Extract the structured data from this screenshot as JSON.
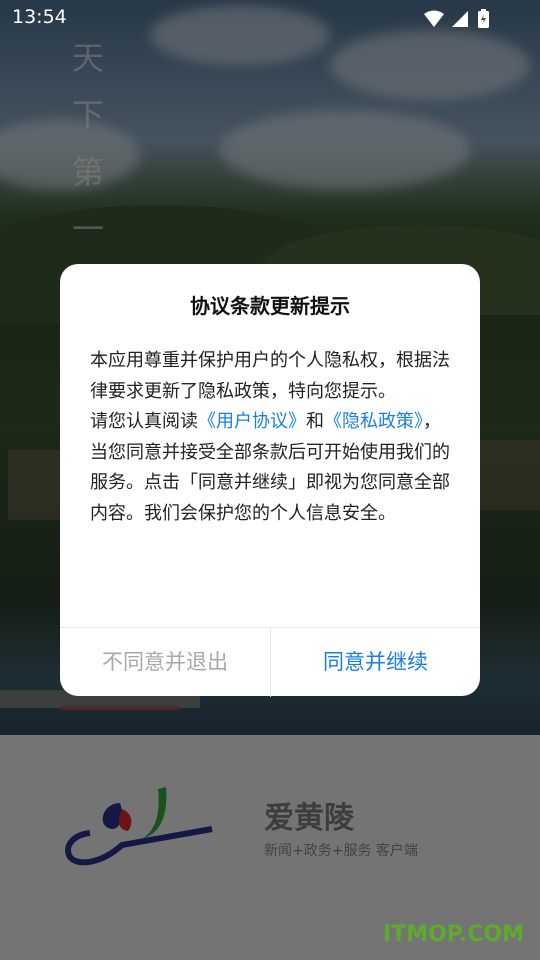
{
  "status_bar": {
    "time": "13:54"
  },
  "splash": {
    "vertical_title": "天下第一陵",
    "app_name": "爱黄陵",
    "slogan": "新闻+政务+服务 客户端"
  },
  "dialog": {
    "title": "协议条款更新提示",
    "paragraph1": "本应用尊重并保护用户的个人隐私权，根据法律要求更新了隐私政策，特向您提示。",
    "p2_before": "请您认真阅读",
    "user_agreement_link": "《用户协议》",
    "p2_and": "和",
    "privacy_policy_link": "《隐私政策》",
    "p2_after": "，当您同意并接受全部条款后可开始使用我们的服务。点击「同意并继续」即视为您同意全部内容。我们会保护您的个人信息安全。",
    "decline_button": "不同意并退出",
    "accept_button": "同意并继续"
  },
  "watermark": "ITMOP.COM",
  "colors": {
    "accent": "#1a7fe3",
    "decline": "#a8a8a8",
    "watermark": "#5cab2b"
  }
}
